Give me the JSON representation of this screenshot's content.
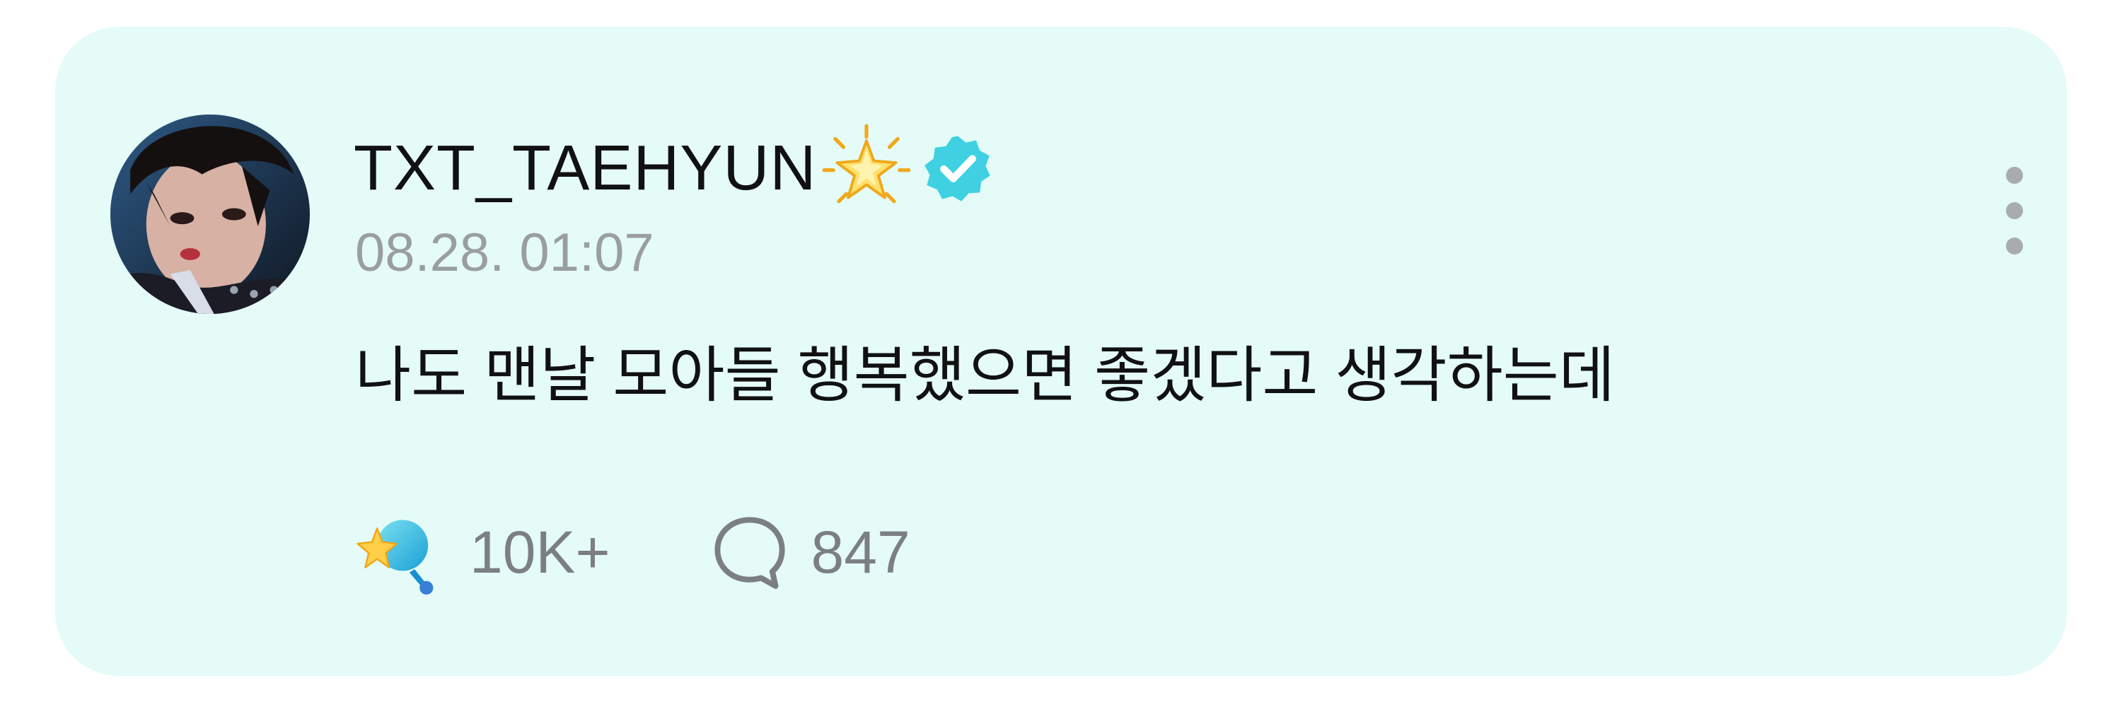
{
  "post": {
    "author": {
      "username": "TXT_TAEHYUN",
      "badge_icon": "sparkle-star-icon",
      "verified_icon": "verified-check-icon"
    },
    "timestamp": "08.28. 01:07",
    "text": "나도 맨날 모아들 행복했으면 좋겠다고 생각하는데",
    "reactions": {
      "likes": "10K+",
      "like_icon": "sparkle-like-icon",
      "comments": "847",
      "comment_icon": "comment-bubble-icon"
    },
    "menu_icon": "more-options-icon"
  },
  "colors": {
    "card_background": "#e4fbf8",
    "verified": "#3fd1e2",
    "timestamp": "#9a9ea1",
    "reaction_text": "#7b7f83"
  }
}
